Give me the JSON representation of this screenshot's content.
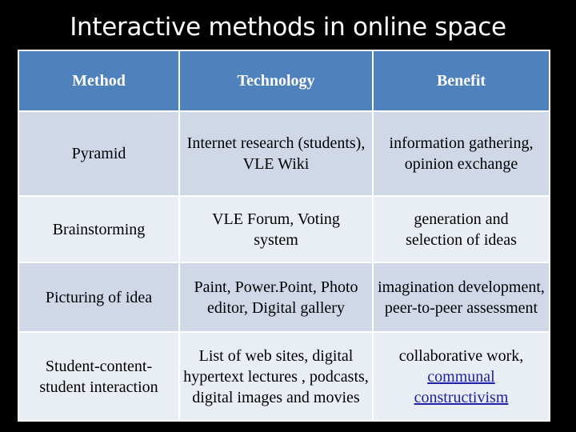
{
  "slide": {
    "title": "Interactive methods in online space"
  },
  "table": {
    "headers": [
      "Method",
      "Technology",
      "Benefit"
    ],
    "rows": [
      {
        "method": "Pyramid",
        "technology": "Internet research (students), VLE Wiki",
        "benefit": "information gathering, opinion exchange"
      },
      {
        "method": "Brainstorming",
        "technology": "VLE Forum, Voting system",
        "benefit": "generation and selection of ideas"
      },
      {
        "method": "Picturing of idea",
        "technology": "Paint, Power.Point, Photo editor, Digital gallery",
        "benefit": "imagination development, peer-to-peer assessment"
      },
      {
        "method": "Student-content-student interaction",
        "technology": "List of web sites, digital hypertext lectures , podcasts, digital images and movies",
        "benefit_text": "collaborative work,",
        "benefit_link": "communal constructivism"
      }
    ]
  },
  "colors": {
    "header_bg": "#4f81bd",
    "row_band_dark": "#d0d8e8",
    "row_band_light": "#e9edf4",
    "link": "#1f1fa6",
    "background": "#000000"
  }
}
